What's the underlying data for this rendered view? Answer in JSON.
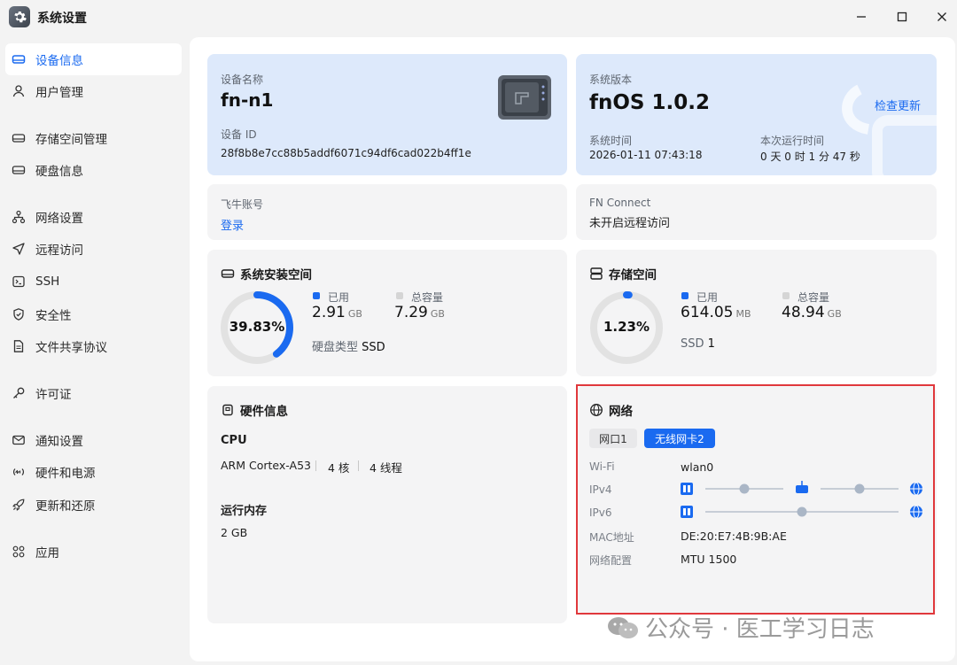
{
  "window": {
    "title": "系统设置"
  },
  "sidebar": {
    "items": [
      {
        "label": "设备信息",
        "icon": "device-icon",
        "active": true
      },
      {
        "label": "用户管理",
        "icon": "user-icon"
      },
      {
        "label": "存储空间管理",
        "icon": "storage-icon"
      },
      {
        "label": "硬盘信息",
        "icon": "disk-icon"
      },
      {
        "label": "网络设置",
        "icon": "network-icon"
      },
      {
        "label": "远程访问",
        "icon": "send-icon"
      },
      {
        "label": "SSH",
        "icon": "terminal-icon"
      },
      {
        "label": "安全性",
        "icon": "shield-icon"
      },
      {
        "label": "文件共享协议",
        "icon": "file-icon"
      },
      {
        "label": "许可证",
        "icon": "key-icon"
      },
      {
        "label": "通知设置",
        "icon": "mail-icon"
      },
      {
        "label": "硬件和电源",
        "icon": "power-icon"
      },
      {
        "label": "更新和还原",
        "icon": "rocket-icon"
      },
      {
        "label": "应用",
        "icon": "apps-icon"
      }
    ]
  },
  "device": {
    "name_label": "设备名称",
    "name": "fn-n1",
    "id_label": "设备 ID",
    "id": "28f8b8e7cc88b5addf6071c94df6cad022b4ff1e"
  },
  "system": {
    "version_label": "系统版本",
    "version": "fnOS  1.0.2",
    "check_update": "检查更新",
    "time_label": "系统时间",
    "time": "2026-01-11 07:43:18",
    "uptime_label": "本次运行时间",
    "uptime": "0 天 0 时 1 分 47 秒"
  },
  "account": {
    "label": "飞牛账号",
    "login": "登录"
  },
  "fnconnect": {
    "label": "FN Connect",
    "status": "未开启远程访问"
  },
  "sys_space": {
    "title": "系统安装空间",
    "percent_text": "39.83%",
    "percent": 39.83,
    "used_label": "已用",
    "used_value": "2.91",
    "used_unit": "GB",
    "total_label": "总容量",
    "total_value": "7.29",
    "total_unit": "GB",
    "disk_type_label": "硬盘类型",
    "disk_type": "SSD"
  },
  "storage": {
    "title": "存储空间",
    "percent_text": "1.23%",
    "percent": 1.23,
    "used_label": "已用",
    "used_value": "614.05",
    "used_unit": "MB",
    "total_label": "总容量",
    "total_value": "48.94",
    "total_unit": "GB",
    "ssd_label": "SSD",
    "ssd_count": "1"
  },
  "hardware": {
    "title": "硬件信息",
    "cpu_label": "CPU",
    "cpu_model": "ARM Cortex-A53",
    "cores": "4 核",
    "threads": "4 线程",
    "mem_label": "运行内存",
    "mem": "2 GB"
  },
  "network": {
    "title": "网络",
    "tabs": [
      "网口1",
      "无线网卡2"
    ],
    "active_tab": 1,
    "rows": [
      {
        "label": "Wi-Fi",
        "value": "wlan0"
      },
      {
        "label": "IPv4",
        "value": ""
      },
      {
        "label": "IPv6",
        "value": ""
      },
      {
        "label": "MAC地址",
        "value": "DE:20:E7:4B:9B:AE"
      },
      {
        "label": "网络配置",
        "value": "MTU 1500"
      }
    ]
  },
  "watermark": {
    "text": "公众号 · 医工学习日志"
  },
  "colors": {
    "accent": "#1a6af0",
    "ring_bg": "#e3e3e3",
    "highlight": "#e0383c"
  }
}
